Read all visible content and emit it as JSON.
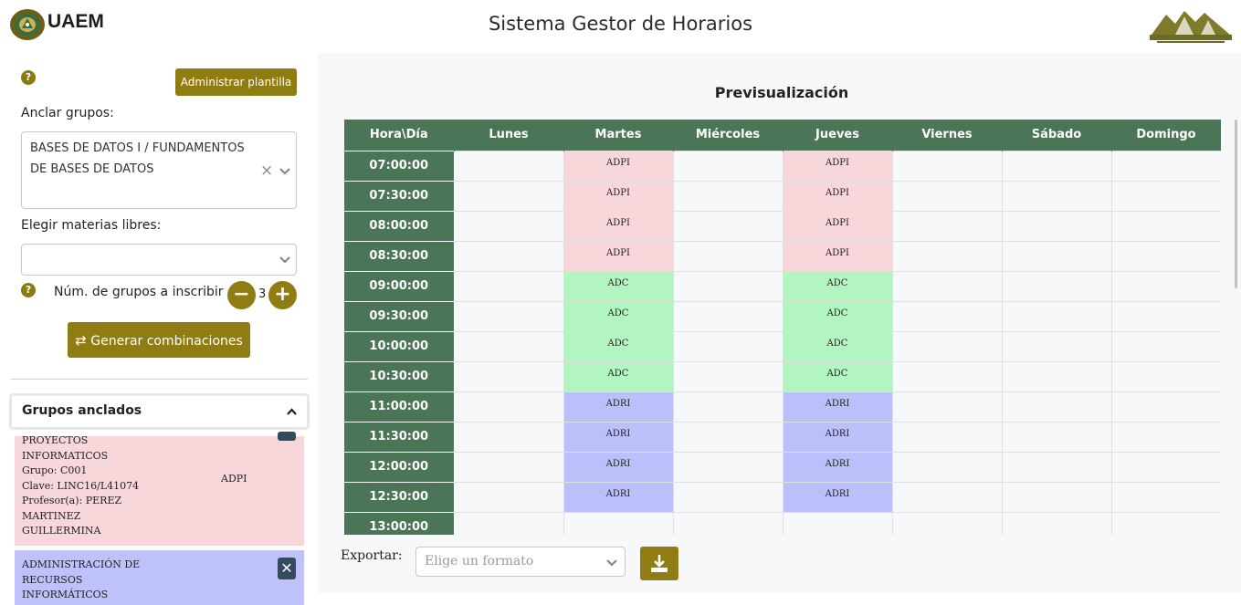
{
  "header": {
    "brand": "UAEM",
    "title": "Sistema Gestor de Horarios",
    "colors": {
      "accent": "#8f7d14",
      "table_header": "#4a7556"
    }
  },
  "sidebar": {
    "help_symbol": "?",
    "admin_template_label": "Administrar plantilla",
    "anchor_groups_label": "Anclar grupos:",
    "anchor_groups_value_line1": "BASES DE DATOS I / FUNDAMENTOS",
    "anchor_groups_value_line2": "DE BASES DE DATOS",
    "clear_symbol": "×",
    "free_subjects_label": "Elegir materias libres:",
    "num_groups_label": "Núm. de grupos a inscribir",
    "num_groups_value": "3",
    "minus_symbol": "−",
    "plus_symbol": "+",
    "generate_label": "Generar combinaciones",
    "anchored_groups_title": "Grupos anclados",
    "cards": [
      {
        "color": "#f7d7da",
        "lines": [
          "PROYECTOS",
          "INFORMATICOS",
          "Grupo: C001",
          "Clave: LINC16/L41074",
          "Profesor(a): PEREZ",
          "MARTINEZ",
          "GUILLERMINA"
        ],
        "abbr": "ADPI"
      },
      {
        "color": "#bfc1fa",
        "lines": [
          "ADMINISTRACIÓN DE",
          "RECURSOS",
          "INFORMÁTICOS"
        ],
        "close_symbol": "✕"
      }
    ]
  },
  "main": {
    "preview_title": "Previsualización",
    "columns": [
      "Hora\\Día",
      "Lunes",
      "Martes",
      "Miércoles",
      "Jueves",
      "Viernes",
      "Sábado",
      "Domingo"
    ],
    "rows": [
      {
        "time": "07:00:00",
        "cells": [
          "",
          "ADPI",
          "",
          "ADPI",
          "",
          "",
          ""
        ],
        "color": "pink"
      },
      {
        "time": "07:30:00",
        "cells": [
          "",
          "ADPI",
          "",
          "ADPI",
          "",
          "",
          ""
        ],
        "color": "pink"
      },
      {
        "time": "08:00:00",
        "cells": [
          "",
          "ADPI",
          "",
          "ADPI",
          "",
          "",
          ""
        ],
        "color": "pink"
      },
      {
        "time": "08:30:00",
        "cells": [
          "",
          "ADPI",
          "",
          "ADPI",
          "",
          "",
          ""
        ],
        "color": "pink"
      },
      {
        "time": "09:00:00",
        "cells": [
          "",
          "ADC",
          "",
          "ADC",
          "",
          "",
          ""
        ],
        "color": "green"
      },
      {
        "time": "09:30:00",
        "cells": [
          "",
          "ADC",
          "",
          "ADC",
          "",
          "",
          ""
        ],
        "color": "green"
      },
      {
        "time": "10:00:00",
        "cells": [
          "",
          "ADC",
          "",
          "ADC",
          "",
          "",
          ""
        ],
        "color": "green"
      },
      {
        "time": "10:30:00",
        "cells": [
          "",
          "ADC",
          "",
          "ADC",
          "",
          "",
          ""
        ],
        "color": "green"
      },
      {
        "time": "11:00:00",
        "cells": [
          "",
          "ADRI",
          "",
          "ADRI",
          "",
          "",
          ""
        ],
        "color": "blue"
      },
      {
        "time": "11:30:00",
        "cells": [
          "",
          "ADRI",
          "",
          "ADRI",
          "",
          "",
          ""
        ],
        "color": "blue"
      },
      {
        "time": "12:00:00",
        "cells": [
          "",
          "ADRI",
          "",
          "ADRI",
          "",
          "",
          ""
        ],
        "color": "blue"
      },
      {
        "time": "12:30:00",
        "cells": [
          "",
          "ADRI",
          "",
          "ADRI",
          "",
          "",
          ""
        ],
        "color": "blue"
      },
      {
        "time": "13:00:00",
        "cells": [
          "",
          "",
          "",
          "",
          "",
          "",
          ""
        ],
        "color": ""
      }
    ],
    "export_label": "Exportar:",
    "export_placeholder": "Elige un formato"
  }
}
